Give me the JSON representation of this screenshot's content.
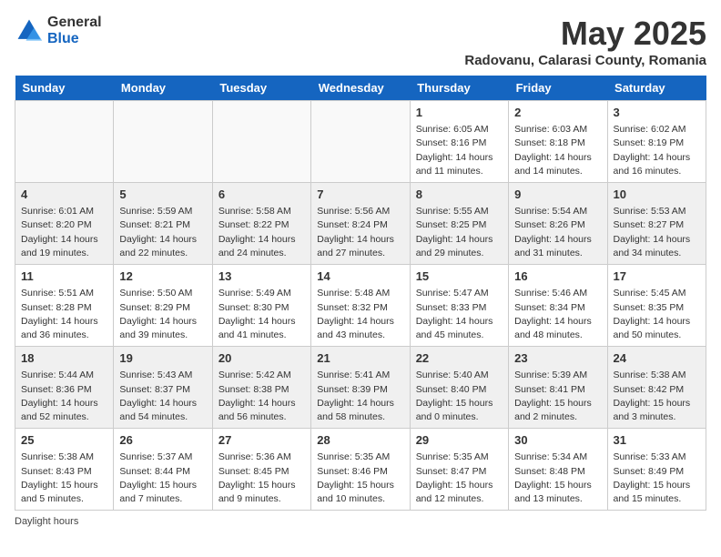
{
  "header": {
    "logo_general": "General",
    "logo_blue": "Blue",
    "month_title": "May 2025",
    "location": "Radovanu, Calarasi County, Romania"
  },
  "days_of_week": [
    "Sunday",
    "Monday",
    "Tuesday",
    "Wednesday",
    "Thursday",
    "Friday",
    "Saturday"
  ],
  "footer": {
    "daylight_label": "Daylight hours"
  },
  "weeks": [
    [
      {
        "day": "",
        "info": ""
      },
      {
        "day": "",
        "info": ""
      },
      {
        "day": "",
        "info": ""
      },
      {
        "day": "",
        "info": ""
      },
      {
        "day": "1",
        "info": "Sunrise: 6:05 AM\nSunset: 8:16 PM\nDaylight: 14 hours\nand 11 minutes."
      },
      {
        "day": "2",
        "info": "Sunrise: 6:03 AM\nSunset: 8:18 PM\nDaylight: 14 hours\nand 14 minutes."
      },
      {
        "day": "3",
        "info": "Sunrise: 6:02 AM\nSunset: 8:19 PM\nDaylight: 14 hours\nand 16 minutes."
      }
    ],
    [
      {
        "day": "4",
        "info": "Sunrise: 6:01 AM\nSunset: 8:20 PM\nDaylight: 14 hours\nand 19 minutes."
      },
      {
        "day": "5",
        "info": "Sunrise: 5:59 AM\nSunset: 8:21 PM\nDaylight: 14 hours\nand 22 minutes."
      },
      {
        "day": "6",
        "info": "Sunrise: 5:58 AM\nSunset: 8:22 PM\nDaylight: 14 hours\nand 24 minutes."
      },
      {
        "day": "7",
        "info": "Sunrise: 5:56 AM\nSunset: 8:24 PM\nDaylight: 14 hours\nand 27 minutes."
      },
      {
        "day": "8",
        "info": "Sunrise: 5:55 AM\nSunset: 8:25 PM\nDaylight: 14 hours\nand 29 minutes."
      },
      {
        "day": "9",
        "info": "Sunrise: 5:54 AM\nSunset: 8:26 PM\nDaylight: 14 hours\nand 31 minutes."
      },
      {
        "day": "10",
        "info": "Sunrise: 5:53 AM\nSunset: 8:27 PM\nDaylight: 14 hours\nand 34 minutes."
      }
    ],
    [
      {
        "day": "11",
        "info": "Sunrise: 5:51 AM\nSunset: 8:28 PM\nDaylight: 14 hours\nand 36 minutes."
      },
      {
        "day": "12",
        "info": "Sunrise: 5:50 AM\nSunset: 8:29 PM\nDaylight: 14 hours\nand 39 minutes."
      },
      {
        "day": "13",
        "info": "Sunrise: 5:49 AM\nSunset: 8:30 PM\nDaylight: 14 hours\nand 41 minutes."
      },
      {
        "day": "14",
        "info": "Sunrise: 5:48 AM\nSunset: 8:32 PM\nDaylight: 14 hours\nand 43 minutes."
      },
      {
        "day": "15",
        "info": "Sunrise: 5:47 AM\nSunset: 8:33 PM\nDaylight: 14 hours\nand 45 minutes."
      },
      {
        "day": "16",
        "info": "Sunrise: 5:46 AM\nSunset: 8:34 PM\nDaylight: 14 hours\nand 48 minutes."
      },
      {
        "day": "17",
        "info": "Sunrise: 5:45 AM\nSunset: 8:35 PM\nDaylight: 14 hours\nand 50 minutes."
      }
    ],
    [
      {
        "day": "18",
        "info": "Sunrise: 5:44 AM\nSunset: 8:36 PM\nDaylight: 14 hours\nand 52 minutes."
      },
      {
        "day": "19",
        "info": "Sunrise: 5:43 AM\nSunset: 8:37 PM\nDaylight: 14 hours\nand 54 minutes."
      },
      {
        "day": "20",
        "info": "Sunrise: 5:42 AM\nSunset: 8:38 PM\nDaylight: 14 hours\nand 56 minutes."
      },
      {
        "day": "21",
        "info": "Sunrise: 5:41 AM\nSunset: 8:39 PM\nDaylight: 14 hours\nand 58 minutes."
      },
      {
        "day": "22",
        "info": "Sunrise: 5:40 AM\nSunset: 8:40 PM\nDaylight: 15 hours\nand 0 minutes."
      },
      {
        "day": "23",
        "info": "Sunrise: 5:39 AM\nSunset: 8:41 PM\nDaylight: 15 hours\nand 2 minutes."
      },
      {
        "day": "24",
        "info": "Sunrise: 5:38 AM\nSunset: 8:42 PM\nDaylight: 15 hours\nand 3 minutes."
      }
    ],
    [
      {
        "day": "25",
        "info": "Sunrise: 5:38 AM\nSunset: 8:43 PM\nDaylight: 15 hours\nand 5 minutes."
      },
      {
        "day": "26",
        "info": "Sunrise: 5:37 AM\nSunset: 8:44 PM\nDaylight: 15 hours\nand 7 minutes."
      },
      {
        "day": "27",
        "info": "Sunrise: 5:36 AM\nSunset: 8:45 PM\nDaylight: 15 hours\nand 9 minutes."
      },
      {
        "day": "28",
        "info": "Sunrise: 5:35 AM\nSunset: 8:46 PM\nDaylight: 15 hours\nand 10 minutes."
      },
      {
        "day": "29",
        "info": "Sunrise: 5:35 AM\nSunset: 8:47 PM\nDaylight: 15 hours\nand 12 minutes."
      },
      {
        "day": "30",
        "info": "Sunrise: 5:34 AM\nSunset: 8:48 PM\nDaylight: 15 hours\nand 13 minutes."
      },
      {
        "day": "31",
        "info": "Sunrise: 5:33 AM\nSunset: 8:49 PM\nDaylight: 15 hours\nand 15 minutes."
      }
    ]
  ]
}
